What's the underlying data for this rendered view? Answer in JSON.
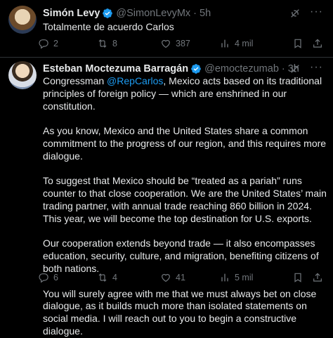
{
  "tweets": [
    {
      "name": "Simón Levy",
      "handle": "@SimonLevyMx",
      "separator": "·",
      "time": "5h",
      "paragraphs": [
        "Totalmente de acuerdo Carlos"
      ],
      "stats": {
        "replies": "2",
        "reposts": "8",
        "likes": "387",
        "views": "4 mil"
      }
    },
    {
      "name": "Esteban Moctezuma Barragán",
      "handle": "@emoctezumab",
      "separator": "·",
      "time": "3h",
      "paragraph1": {
        "prefix": "Congressman ",
        "mention": "@RepCarlos",
        "suffix": ", Mexico acts based on its traditional principles of foreign policy — which are enshrined in our constitution."
      },
      "paragraphs": [
        "As you know, Mexico and the United States share a common commitment to the progress of our region, and this requires more dialogue.",
        "To suggest that Mexico should be “treated as a pariah” runs counter to that close cooperation. We are the United States’ main trading partner, with annual trade reaching 860 billion in 2024. This year, we will become the top destination for U.S. exports.",
        "Our cooperation extends beyond trade — it also encompasses education, security, culture, and migration, benefiting citizens of both nations.",
        "You will surely agree with me that we must always bet on close dialogue, as it builds much more than isolated statements on social media. I will reach out to you to begin a constructive dialogue."
      ],
      "stats": {
        "replies": "6",
        "reposts": "4",
        "likes": "41",
        "views": "5 mil"
      }
    }
  ],
  "colors": {
    "background": "#000000",
    "text": "#e7e9ea",
    "muted": "#71767b",
    "accent": "#1d9bf0",
    "divider": "#2f3336"
  },
  "icons": [
    "verified-badge-icon",
    "grok-icon",
    "more-icon",
    "reply-icon",
    "repost-icon",
    "like-icon",
    "views-icon",
    "bookmark-icon",
    "share-icon"
  ],
  "more_glyph": "···"
}
